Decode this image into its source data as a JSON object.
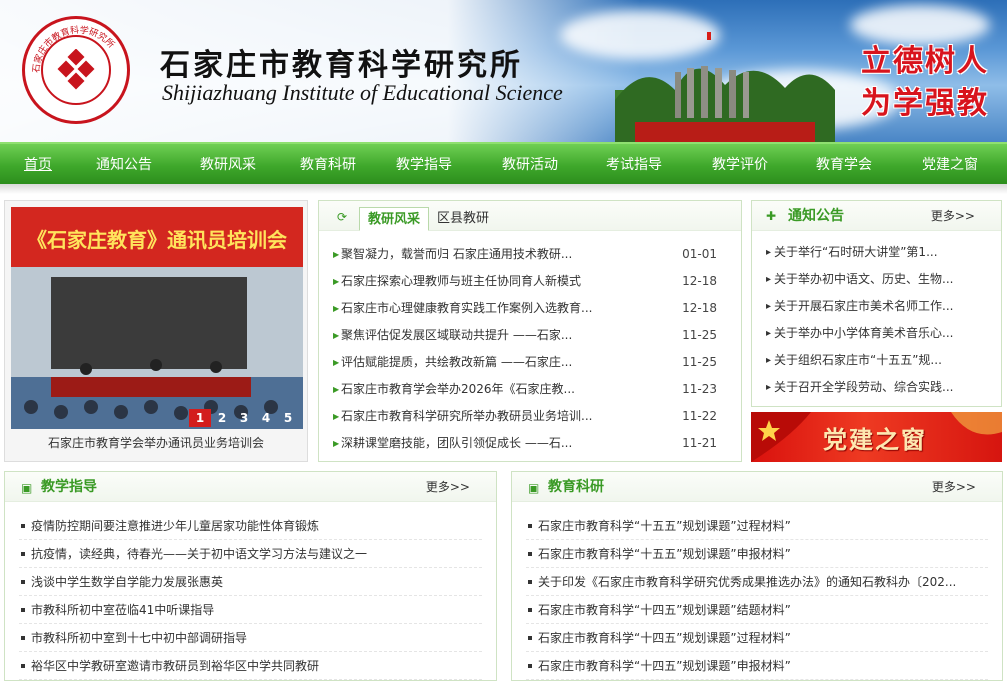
{
  "header": {
    "title_cn": "石家庄市教育科学研究所",
    "title_en": "Shijiazhuang Institute of Educational  Science",
    "slogan_line1": "立德树人",
    "slogan_line2": "为学强教",
    "logo_ring_text": "石家庄市教育科学研究所",
    "colors": {
      "accent_red": "#c8141d",
      "brand_green": "#3fa82b"
    }
  },
  "nav": {
    "items": [
      "首页",
      "通知公告",
      "教研风采",
      "教育科研",
      "教学指导",
      "教研活动",
      "考试指导",
      "教学评价",
      "教育学会",
      "党建之窗"
    ],
    "active": "首页"
  },
  "slideshow": {
    "banner_text": "《石家庄教育》通讯员培训会",
    "caption": "石家庄市教育学会举办通讯员业务培训会",
    "pages": [
      "1",
      "2",
      "3",
      "4",
      "5"
    ],
    "current": "1"
  },
  "tabs": {
    "active_label": "教研风采",
    "other_label": "区县教研",
    "items": [
      {
        "title": "聚智凝力，载誉而归 石家庄通用技术教研...",
        "date": "01-01"
      },
      {
        "title": "石家庄探索心理教师与班主任协同育人新模式",
        "date": "12-18"
      },
      {
        "title": "石家庄市心理健康教育实践工作案例入选教育...",
        "date": "12-18"
      },
      {
        "title": "聚焦评估促发展区域联动共提升 ——石家...",
        "date": "11-25"
      },
      {
        "title": "评估赋能提质，共绘教改新篇 ——石家庄...",
        "date": "11-25"
      },
      {
        "title": "石家庄市教育学会举办2026年《石家庄教...",
        "date": "11-23"
      },
      {
        "title": "石家庄市教育科学研究所举办教研员业务培训...",
        "date": "11-22"
      },
      {
        "title": "深耕课堂磨技能，团队引领促成长 ——石...",
        "date": "11-21"
      }
    ]
  },
  "notice": {
    "title": "通知公告",
    "more": "更多>>",
    "items": [
      "关于举行“石时研大讲堂”第1...",
      "关于举办初中语文、历史、生物...",
      "关于开展石家庄市美术名师工作...",
      "关于举办中小学体育美术音乐心...",
      "关于组织石家庄市“十五五”规...",
      "关于召开全学段劳动、综合实践..."
    ]
  },
  "party": {
    "label": "党建之窗"
  },
  "teaching": {
    "title": "教学指导",
    "more": "更多>>",
    "items": [
      "疫情防控期间要注意推进少年儿童居家功能性体育锻炼",
      "抗疫情，读经典，待春光——关于初中语文学习方法与建议之一",
      "浅谈中学生数学自学能力发展张惠英",
      "市教科所初中室莅临41中听课指导",
      "市教科所初中室到十七中初中部调研指导",
      "裕华区中学教研室邀请市教研员到裕华区中学共同教研"
    ]
  },
  "research": {
    "title": "教育科研",
    "more": "更多>>",
    "items": [
      "石家庄市教育科学“十五五”规划课题”过程材料”",
      "石家庄市教育科学“十五五”规划课题”申报材料”",
      "关于印发《石家庄市教育科学研究优秀成果推选办法》的通知石教科办〔202...",
      "石家庄市教育科学“十四五”规划课题”结题材料”",
      "石家庄市教育科学“十四五”规划课题”过程材料”",
      "石家庄市教育科学“十四五”规划课题”申报材料”"
    ]
  }
}
